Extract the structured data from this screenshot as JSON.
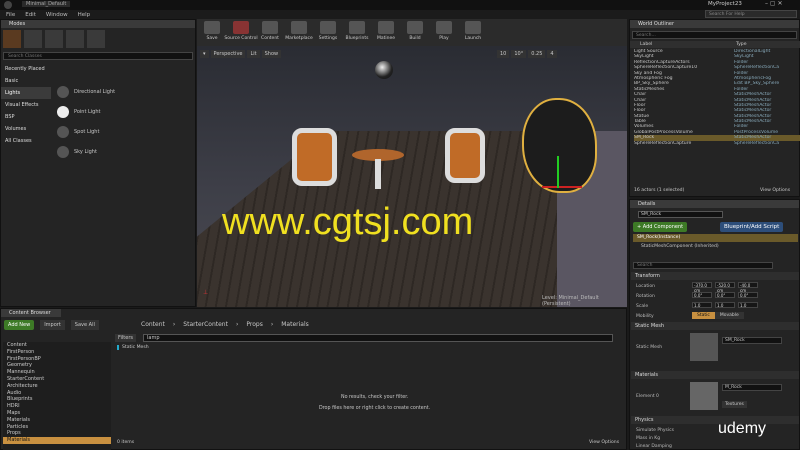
{
  "window": {
    "project_title": "Minimal_Default",
    "project_name": "MyProject23",
    "search_help": "Search For Help"
  },
  "menu": [
    "File",
    "Edit",
    "Window",
    "Help"
  ],
  "modes": {
    "tab": "Modes",
    "search_placeholder": "Search Classes",
    "categories": [
      "Recently Placed",
      "Basic",
      "Lights",
      "Visual Effects",
      "BSP",
      "Volumes",
      "All Classes"
    ],
    "items": [
      "Directional Light",
      "Point Light",
      "Spot Light",
      "Sky Light"
    ]
  },
  "toolbar": [
    "Save",
    "Source Control",
    "Content",
    "Marketplace",
    "Settings",
    "Blueprints",
    "Matinee",
    "Build",
    "Play",
    "Launch"
  ],
  "viewport": {
    "perspective": "Perspective",
    "lit": "Lit",
    "show": "Show",
    "grid": "10",
    "rot": "10°",
    "scale": "0.25",
    "cam": "4",
    "level": "Level:  Minimal_Default (Persistent)",
    "watermark": "www.cgtsj.com"
  },
  "outliner": {
    "tab": "World Outliner",
    "search_placeholder": "Search...",
    "col_label": "Label",
    "col_type": "Type",
    "rows": [
      [
        "Light Source",
        "DirectionalLight"
      ],
      [
        "SkyLight",
        "SkyLight"
      ],
      [
        "ReflectionCaptureActors",
        "Folder"
      ],
      [
        "SphereReflectionCapture10",
        "SphereReflectionCa"
      ],
      [
        "Sky and Fog",
        "Folder"
      ],
      [
        "Atmospheric Fog",
        "AtmosphericFog"
      ],
      [
        "BP_Sky_Sphere",
        "Edit BP_Sky_Sphere"
      ],
      [
        "StaticMeshes",
        "Folder"
      ],
      [
        "Chair",
        "StaticMeshActor"
      ],
      [
        "Chair",
        "StaticMeshActor"
      ],
      [
        "Floor",
        "StaticMeshActor"
      ],
      [
        "Floor",
        "StaticMeshActor"
      ],
      [
        "Statue",
        "StaticMeshActor"
      ],
      [
        "Table",
        "StaticMeshActor"
      ],
      [
        "Volumes",
        "Folder"
      ],
      [
        "GlobalPostProcessVolume",
        "PostProcessVolume"
      ],
      [
        "SM_Rock",
        "StaticMeshActor"
      ],
      [
        "SphereReflectionCapture",
        "SphereReflectionCa"
      ]
    ],
    "status": "16 actors (1 selected)",
    "view_options": "View Options"
  },
  "details": {
    "tab": "Details",
    "name": "SM_Rock",
    "add_component": "+ Add Component",
    "blueprint": "Blueprint/Add Script",
    "instance": "SM_Rock(Instance)",
    "component": "StaticMeshComponent (Inherited)",
    "search_placeholder": "Search",
    "transform": "Transform",
    "location": "Location",
    "rotation": "Rotation",
    "scale": "Scale",
    "mobility": "Mobility",
    "loc": [
      "-370.0 cm",
      "-520.0 cm",
      "-40.0 cm"
    ],
    "rot": [
      "0.0°",
      "0.0°",
      "0.0°"
    ],
    "scl": [
      "1.0",
      "1.0",
      "1.0"
    ],
    "mob_static": "Static",
    "mob_movable": "Movable",
    "static_mesh_section": "Static Mesh",
    "static_mesh_label": "Static Mesh",
    "static_mesh_value": "SM_Rock",
    "materials_section": "Materials",
    "element0": "Element 0",
    "material_value": "M_Rock",
    "textures": "Textures",
    "physics": "Physics",
    "simulate": "Simulate Physics",
    "mass": "Mass in Kg",
    "linear": "Linear Damping"
  },
  "content": {
    "tab": "Content Browser",
    "add_new": "Add New",
    "import": "Import",
    "save_all": "Save All",
    "breadcrumb": [
      "Content",
      "StarterContent",
      "Props",
      "Materials"
    ],
    "filters": "Filters",
    "search_value": "lamp",
    "filter_chip": "Static Mesh",
    "empty1": "No results, check your filter.",
    "empty2": "Drop files here or right click to create content.",
    "items_count": "0 items",
    "view_options": "View Options",
    "tree": [
      "Content",
      "FirstPerson",
      "FirstPersonBP",
      "Geometry",
      "Mannequin",
      "StarterContent",
      "Architecture",
      "Audio",
      "Blueprints",
      "HDRI",
      "Maps",
      "Materials",
      "Particles",
      "Props",
      "Materials"
    ]
  },
  "udemy": "udemy"
}
